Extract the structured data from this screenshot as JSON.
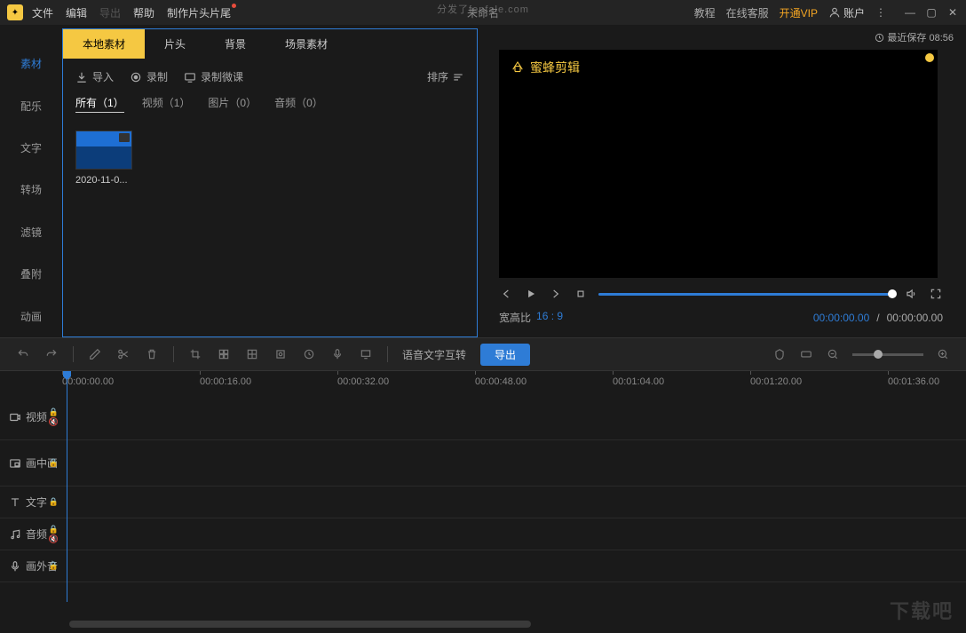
{
  "watermark": "分发了fenfale.com",
  "title": "未命名",
  "menu": {
    "file": "文件",
    "edit": "编辑",
    "export": "导出",
    "help": "帮助",
    "titles": "制作片头片尾"
  },
  "right_menu": {
    "tutorial": "教程",
    "service": "在线客服",
    "vip": "开通VIP",
    "account": "账户"
  },
  "sidebar": [
    "素材",
    "配乐",
    "文字",
    "转场",
    "滤镜",
    "叠附",
    "动画"
  ],
  "material_tabs": [
    "本地素材",
    "片头",
    "背景",
    "场景素材"
  ],
  "import_bar": {
    "import": "导入",
    "record": "录制",
    "micro": "录制微课",
    "sort": "排序"
  },
  "filters": {
    "all": "所有（1）",
    "video": "视频（1）",
    "image": "图片（0）",
    "audio": "音频（0）"
  },
  "thumb_label": "2020-11-0...",
  "save_info": "最近保存 08:56",
  "preview_logo": "蜜蜂剪辑",
  "aspect": {
    "label": "宽高比",
    "value": "16 : 9"
  },
  "time": {
    "current": "00:00:00.00",
    "sep": "/",
    "total": "00:00:00.00"
  },
  "toolbar": {
    "voice": "语音文字互转",
    "export": "导出"
  },
  "ruler": [
    "00:00:00.00",
    "00:00:16.00",
    "00:00:32.00",
    "00:00:48.00",
    "00:01:04.00",
    "00:01:20.00",
    "00:01:36.00"
  ],
  "tracks": {
    "video": "视频",
    "pip": "画中画",
    "text": "文字",
    "audio": "音频",
    "voice": "画外音"
  },
  "bottom_water": "下载吧"
}
